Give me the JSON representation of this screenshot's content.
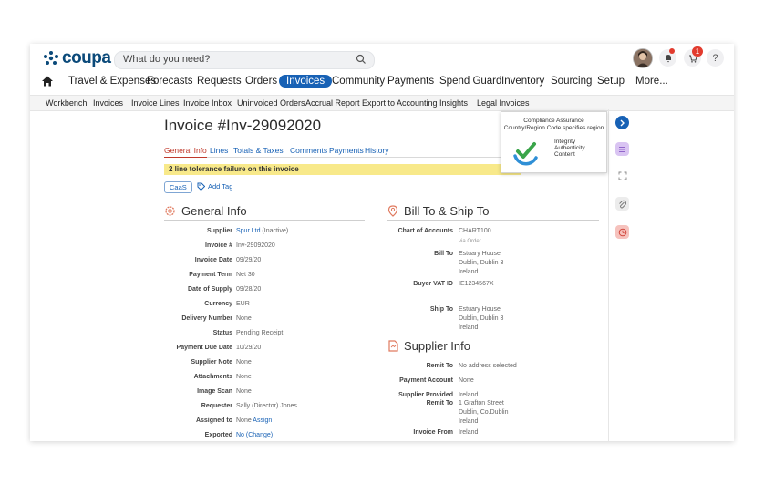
{
  "app": {
    "logo_text": "coupa"
  },
  "search": {
    "placeholder": "What do you need?"
  },
  "topbar": {
    "notifications_badge": "1",
    "help": "?"
  },
  "main_nav": [
    "Travel & Expenses",
    "Forecasts",
    "Requests",
    "Orders",
    "Invoices",
    "Community",
    "Payments",
    "Spend Guard",
    "Inventory",
    "Sourcing",
    "Setup",
    "More..."
  ],
  "sub_nav": [
    "Workbench",
    "Invoices",
    "Invoice Lines",
    "Invoice Inbox",
    "Uninvoiced Orders",
    "Accrual Report",
    "Export to Accounting",
    "Insights",
    "Legal Invoices"
  ],
  "invoice": {
    "title": "Invoice #Inv-29092020",
    "tabs": [
      "General Info",
      "Lines",
      "Totals & Taxes",
      "Comments",
      "Payments",
      "History"
    ],
    "alert": "2 line tolerance failure on this invoice",
    "tag_chip": "CaaS",
    "add_tag": "Add Tag"
  },
  "general_info": {
    "heading": "General Info",
    "fields": {
      "supplier": {
        "label": "Supplier",
        "value": "Spur Ltd",
        "suffix": "(Inactive)"
      },
      "invoice_no": {
        "label": "Invoice #",
        "value": "Inv-29092020"
      },
      "invoice_date": {
        "label": "Invoice Date",
        "value": "09/29/20"
      },
      "payment_term": {
        "label": "Payment Term",
        "value": "Net 30"
      },
      "date_of_supply": {
        "label": "Date of Supply",
        "value": "09/28/20"
      },
      "currency": {
        "label": "Currency",
        "value": "EUR"
      },
      "delivery_number": {
        "label": "Delivery Number",
        "value": "None"
      },
      "status": {
        "label": "Status",
        "value": "Pending Receipt"
      },
      "payment_due_date": {
        "label": "Payment Due Date",
        "value": "10/29/20"
      },
      "supplier_note": {
        "label": "Supplier Note",
        "value": "None"
      },
      "attachments": {
        "label": "Attachments",
        "value": "None"
      },
      "image_scan": {
        "label": "Image Scan",
        "value": "None"
      },
      "requester": {
        "label": "Requester",
        "value": "Sally (Director) Jones"
      },
      "assigned_to": {
        "label": "Assigned to",
        "value": "None",
        "action": "Assign"
      },
      "exported": {
        "label": "Exported",
        "value": "No",
        "action": "(Change)"
      }
    }
  },
  "bill_to": {
    "heading": "Bill To & Ship To",
    "chart_of_accounts": {
      "label": "Chart of Accounts",
      "value": "CHART100",
      "sub": "via Order"
    },
    "bill_to": {
      "label": "Bill To",
      "lines": [
        "Estuary House",
        "Dublin, Dublin 3",
        "Ireland"
      ]
    },
    "buyer_vat": {
      "label": "Buyer VAT ID",
      "value": "IE1234567X"
    },
    "ship_to": {
      "label": "Ship To",
      "lines": [
        "Estuary House",
        "Dublin, Dublin 3",
        "Ireland"
      ]
    }
  },
  "supplier_info": {
    "heading": "Supplier Info",
    "remit_to": {
      "label": "Remit To",
      "value": "No address selected"
    },
    "payment_account": {
      "label": "Payment Account",
      "value": "None"
    },
    "supplier_provided": {
      "label": "Supplier Provided",
      "value": "Ireland"
    },
    "remit_to2": {
      "label": "Remit To",
      "lines": [
        "1 Grafton Street",
        "Dublin, Co.Dublin",
        "Ireland"
      ]
    },
    "invoice_from": {
      "label": "Invoice From",
      "value": "Ireland"
    }
  },
  "compliance_popup": {
    "title_line1": "Compliance Assurance",
    "title_line2": "Country/Region Code specifies region",
    "items": [
      "Integrity",
      "Authenticity",
      "Content"
    ]
  },
  "colors": {
    "accent": "#1761b5",
    "alert_bg": "#f8e98a",
    "check_green": "#3aa54a",
    "check_blue": "#2f8fd6"
  }
}
